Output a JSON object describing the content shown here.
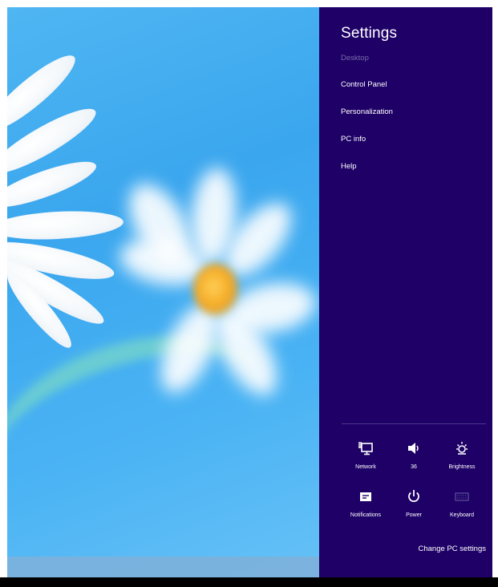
{
  "settings": {
    "title": "Settings",
    "context": "Desktop",
    "menu_items": [
      {
        "label": "Control Panel"
      },
      {
        "label": "Personalization"
      },
      {
        "label": "PC info"
      },
      {
        "label": "Help"
      }
    ],
    "quick_settings": [
      {
        "label": "Network",
        "icon": "network-icon"
      },
      {
        "label": "36",
        "icon": "speaker-icon"
      },
      {
        "label": "Brightness",
        "icon": "brightness-icon"
      },
      {
        "label": "Notifications",
        "icon": "notifications-icon"
      },
      {
        "label": "Power",
        "icon": "power-icon"
      },
      {
        "label": "Keyboard",
        "icon": "keyboard-icon"
      }
    ],
    "change_pc_settings": "Change PC settings",
    "colors": {
      "panel_background": "#1e0067",
      "subdued_text": "#7a6aa8",
      "desktop_blue": "#3aa6ee"
    }
  }
}
